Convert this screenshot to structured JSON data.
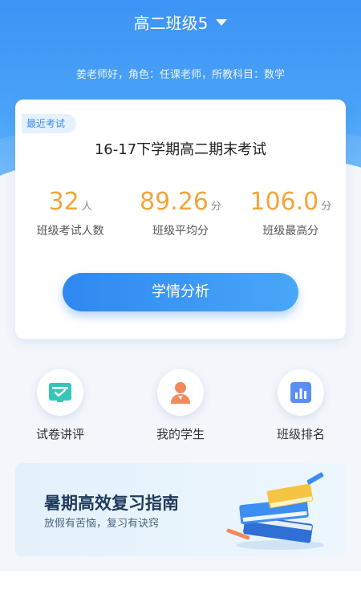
{
  "header": {
    "class_title": "高二班级5",
    "teacher_info": "姜老师好，角色：任课老师，所教科目：数学"
  },
  "exam_card": {
    "badge": "最近考试",
    "exam_name": "16-17下学期高二期末考试",
    "stats": [
      {
        "value": "32",
        "unit": "人",
        "label": "班级考试人数"
      },
      {
        "value": "89.26",
        "unit": "分",
        "label": "班级平均分"
      },
      {
        "value": "106.0",
        "unit": "分",
        "label": "班级最高分"
      }
    ],
    "button_label": "学情分析"
  },
  "shortcuts": [
    {
      "label": "试卷讲评",
      "icon": "paper-review-icon"
    },
    {
      "label": "我的学生",
      "icon": "student-icon"
    },
    {
      "label": "班级排名",
      "icon": "bar-chart-icon"
    }
  ],
  "banner": {
    "title": "暑期高效复习指南",
    "subtitle": "放假有苦恼，复习有诀窍"
  },
  "colors": {
    "primary_blue": "#3a8ef0",
    "stat_orange": "#f3a53a",
    "review_green": "#35c6b8",
    "student_orange": "#f08a5d",
    "ranking_blue": "#5b8ef5"
  }
}
